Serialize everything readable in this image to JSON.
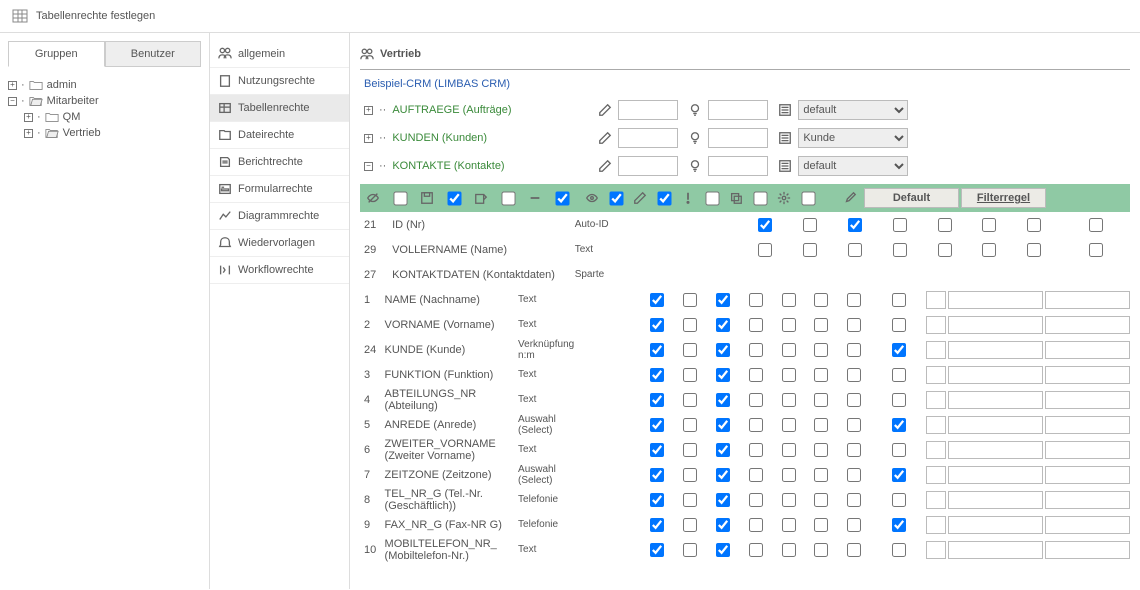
{
  "page_title": "Tabellenrechte festlegen",
  "tabs": {
    "groups": "Gruppen",
    "users": "Benutzer"
  },
  "tree": [
    {
      "label": "admin",
      "indent": 0,
      "expand": "+"
    },
    {
      "label": "Mitarbeiter",
      "indent": 0,
      "expand": "−",
      "open": true
    },
    {
      "label": "QM",
      "indent": 1,
      "expand": "+"
    },
    {
      "label": "Vertrieb",
      "indent": 1,
      "expand": "+",
      "open": true
    }
  ],
  "menu": [
    {
      "k": "allgemein",
      "label": "allgemein"
    },
    {
      "k": "nutzungsrechte",
      "label": "Nutzungsrechte"
    },
    {
      "k": "tabellenrechte",
      "label": "Tabellenrechte",
      "active": true
    },
    {
      "k": "dateirechte",
      "label": "Dateirechte"
    },
    {
      "k": "berichtrechte",
      "label": "Berichtrechte"
    },
    {
      "k": "formularrechte",
      "label": "Formularrechte"
    },
    {
      "k": "diagrammrechte",
      "label": "Diagrammrechte"
    },
    {
      "k": "wiedervorlagen",
      "label": "Wiedervorlagen"
    },
    {
      "k": "workflowrechte",
      "label": "Workflowrechte"
    }
  ],
  "main_title": "Vertrieb",
  "breadcrumb": "Beispiel-CRM (LIMBAS CRM)",
  "categories": [
    {
      "label": "AUFTRAEGE (Aufträge)",
      "select": "default",
      "expand": "+"
    },
    {
      "label": "KUNDEN (Kunden)",
      "select": "Kunde",
      "expand": "+"
    },
    {
      "label": "KONTAKTE (Kontakte)",
      "select": "default",
      "expand": "−"
    }
  ],
  "hdr": {
    "default": "Default",
    "filter": "Filterregel"
  },
  "fields": [
    {
      "id": "21",
      "name": "ID (Nr)",
      "type": "Auto-ID",
      "c": [
        true,
        false,
        true,
        false,
        false,
        false,
        false,
        false
      ],
      "inputs": false
    },
    {
      "id": "29",
      "name": "VOLLERNAME (Name)",
      "type": "Text",
      "c": [
        false,
        false,
        false,
        false,
        false,
        false,
        false,
        false
      ],
      "inputs": false
    },
    {
      "id": "27",
      "name": "KONTAKTDATEN (Kontaktdaten)",
      "type": "Sparte",
      "c": [
        null,
        null,
        null,
        null,
        null,
        null,
        null,
        null
      ],
      "inputs": false
    },
    {
      "id": "1",
      "name": "NAME (Nachname)",
      "type": "Text",
      "c": [
        true,
        false,
        true,
        false,
        false,
        false,
        false,
        false
      ],
      "inputs": true
    },
    {
      "id": "2",
      "name": "VORNAME (Vorname)",
      "type": "Text",
      "c": [
        true,
        false,
        true,
        false,
        false,
        false,
        false,
        false
      ],
      "inputs": true
    },
    {
      "id": "24",
      "name": "KUNDE (Kunde)",
      "type": "Verknüpfung n:m",
      "c": [
        true,
        false,
        true,
        false,
        false,
        false,
        false,
        true
      ],
      "inputs": true
    },
    {
      "id": "3",
      "name": "FUNKTION (Funktion)",
      "type": "Text",
      "c": [
        true,
        false,
        true,
        false,
        false,
        false,
        false,
        false
      ],
      "inputs": true
    },
    {
      "id": "4",
      "name": "ABTEILUNGS_NR (Abteilung)",
      "type": "Text",
      "c": [
        true,
        false,
        true,
        false,
        false,
        false,
        false,
        false
      ],
      "inputs": true
    },
    {
      "id": "5",
      "name": "ANREDE (Anrede)",
      "type": "Auswahl (Select)",
      "c": [
        true,
        false,
        true,
        false,
        false,
        false,
        false,
        true
      ],
      "inputs": true
    },
    {
      "id": "6",
      "name": "ZWEITER_VORNAME (Zweiter Vorname)",
      "type": "Text",
      "c": [
        true,
        false,
        true,
        false,
        false,
        false,
        false,
        false
      ],
      "inputs": true
    },
    {
      "id": "7",
      "name": "ZEITZONE (Zeitzone)",
      "type": "Auswahl (Select)",
      "c": [
        true,
        false,
        true,
        false,
        false,
        false,
        false,
        true
      ],
      "inputs": true
    },
    {
      "id": "8",
      "name": "TEL_NR_G (Tel.-Nr. (Geschäftlich))",
      "type": "Telefonie",
      "c": [
        true,
        false,
        true,
        false,
        false,
        false,
        false,
        false
      ],
      "inputs": true
    },
    {
      "id": "9",
      "name": "FAX_NR_G (Fax-NR G)",
      "type": "Telefonie",
      "c": [
        true,
        false,
        true,
        false,
        false,
        false,
        false,
        true
      ],
      "inputs": true
    },
    {
      "id": "10",
      "name": "MOBILTELEFON_NR_ (Mobiltelefon-Nr.)",
      "type": "Text",
      "c": [
        true,
        false,
        true,
        false,
        false,
        false,
        false,
        false
      ],
      "inputs": true
    }
  ]
}
